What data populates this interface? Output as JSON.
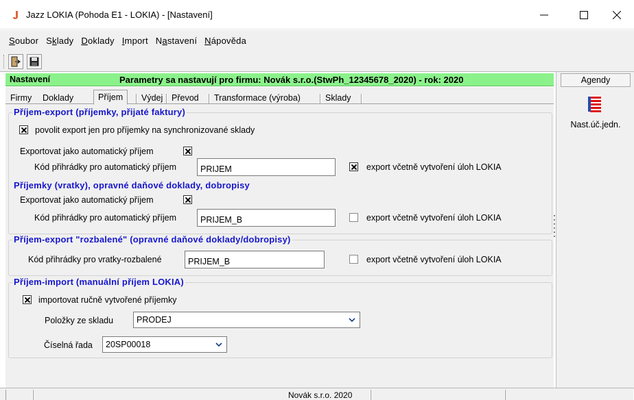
{
  "window": {
    "title": "Jazz LOKIA (Pohoda E1 - LOKIA) - [Nastavení]",
    "icon": "jazz-app-icon"
  },
  "menu": [
    {
      "label": "Soubor",
      "accel": "S",
      "rest": "oubor"
    },
    {
      "label": "Sklady",
      "pre": "S",
      "accel": "k",
      "rest": "lady"
    },
    {
      "label": "Doklady",
      "accel": "D",
      "rest": "oklady"
    },
    {
      "label": "Import",
      "accel": "I",
      "rest": "mport"
    },
    {
      "label": "Nastavení",
      "pre": "N",
      "accel": "a",
      "rest": "stavení"
    },
    {
      "label": "Nápověda",
      "accel": "N",
      "rest": "ápověda"
    }
  ],
  "toolbar": {
    "exit_icon": "exit-door-icon",
    "save_icon": "floppy-save-icon"
  },
  "header": {
    "label": "Nastavení",
    "message": "Parametry sa nastavují pro firmu: Novák s.r.o.(StwPh_12345678_2020) - rok: 2020",
    "color": "#8bf28b"
  },
  "tabs": [
    "Firmy",
    "Doklady",
    "Příjem",
    "Výdej",
    "Převod",
    "Transformace (výroba)",
    "Sklady"
  ],
  "active_tab": "Příjem",
  "groups": {
    "export": {
      "title": "Příjem-export (příjemky, přijaté faktury)",
      "sync_only": {
        "label": "povolit export jen pro příjemky na synchronizované sklady",
        "checked": true
      },
      "auto_label": "Exportovat jako automatický příjem",
      "auto_checked": true,
      "code_label": "Kód přihrádky pro automatický příjem",
      "code_value": "PRIJEM",
      "tasks": {
        "label": "export včetně vytvoření úloh LOKIA",
        "checked": true
      }
    },
    "returns": {
      "title": "Příjemky (vratky), opravné daňové doklady, dobropisy",
      "auto_label": "Exportovat jako automatický příjem",
      "auto_checked": true,
      "code_label": "Kód přihrádky pro automatický příjem",
      "code_value": "PRIJEM_B",
      "tasks": {
        "label": "export včetně vytvoření úloh LOKIA",
        "checked": false
      }
    },
    "unpacked": {
      "title": "Příjem-export \"rozbalené\" (opravné daňové doklady/dobropisy)",
      "code_label": "Kód přihrádky pro vratky-rozbalené",
      "code_value": "PRIJEM_B",
      "tasks": {
        "label": "export včetně vytvoření úloh LOKIA",
        "checked": false
      }
    },
    "import": {
      "title": "Příjem-import (manuální příjem LOKIA)",
      "manual": {
        "label": "importovat ručně vytvořené příjemky",
        "checked": true
      },
      "items_label": "Položky ze skladu",
      "items_value": "PRODEJ",
      "series_label": "Číselná řada",
      "series_value": "20SP00018"
    }
  },
  "side": {
    "agendy_label": "Agendy",
    "agenda_icon": "settings-list-icon",
    "agenda_label": "Nast.úč.jedn."
  },
  "status": {
    "company": "Novák s.r.o. 2020"
  }
}
